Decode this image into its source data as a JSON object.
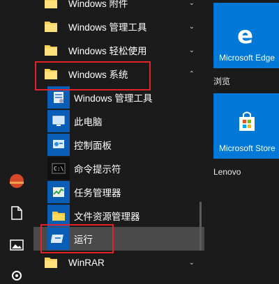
{
  "start_list": {
    "items": [
      {
        "label": "Windows 附件",
        "expand": "⌄"
      },
      {
        "label": "Windows 管理工具",
        "expand": "⌄"
      },
      {
        "label": "Windows 轻松使用",
        "expand": "⌄"
      },
      {
        "label": "Windows 系统",
        "expand": "⌃"
      },
      {
        "label": "Windows 管理工具"
      },
      {
        "label": "此电脑"
      },
      {
        "label": "控制面板"
      },
      {
        "label": "命令提示符"
      },
      {
        "label": "任务管理器"
      },
      {
        "label": "文件资源管理器"
      },
      {
        "label": "运行"
      },
      {
        "label": "WinRAR",
        "expand": "⌄"
      }
    ]
  },
  "tiles": {
    "edge": {
      "label": "Microsoft Edge"
    },
    "browse_label": "浏览",
    "store": {
      "label": "Microsoft Store"
    },
    "lenovo_label": "Lenovo"
  },
  "colors": {
    "accent": "#0078d7",
    "highlight_box": "#e2232b",
    "background": "#1b1b1b"
  }
}
